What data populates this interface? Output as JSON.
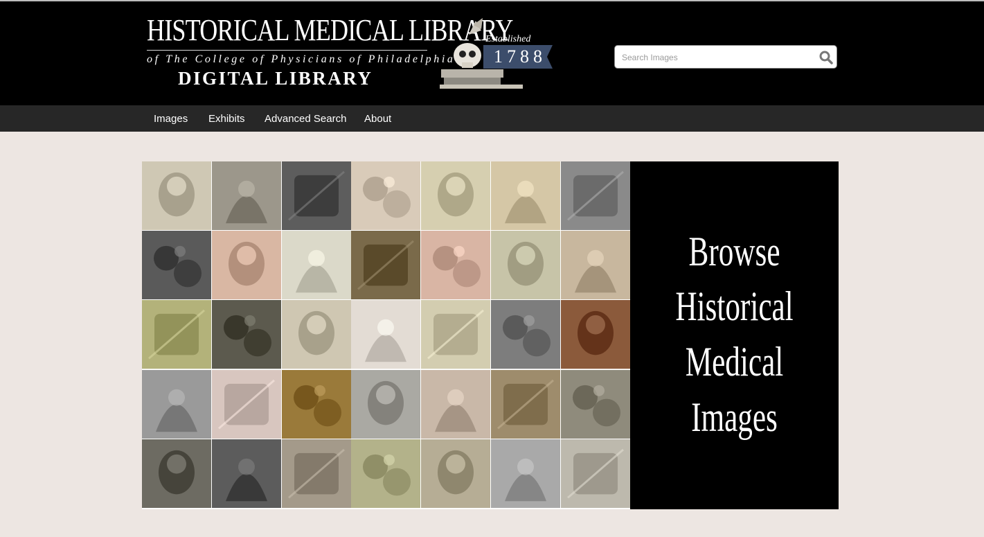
{
  "header": {
    "logo_line1": "HISTORICAL MEDICAL LIBRARY",
    "logo_line2": "of The College of Physicians of Philadelphia",
    "logo_line3": "DIGITAL LIBRARY",
    "badge_label": "Established",
    "badge_year": "1788"
  },
  "search": {
    "placeholder": "Search Images",
    "icon": "search-icon"
  },
  "nav": {
    "items": [
      "Images",
      "Exhibits",
      "Advanced Search",
      "About"
    ]
  },
  "browse": {
    "lines": [
      "Browse",
      "Historical",
      "Medical",
      "Images"
    ]
  },
  "mosaic": {
    "tile_count": 35,
    "tile_tones": [
      "#cfc8b4",
      "#9c978b",
      "#5d5d5d",
      "#d9cbb9",
      "#d6cfb0",
      "#d5c7a6",
      "#8a8a8a",
      "#5a5a5a",
      "#d9b7a3",
      "#dbd9c9",
      "#7a6a4a",
      "#d9b5a4",
      "#c7c4a8",
      "#c8b79e",
      "#b3b27a",
      "#5c5a4e",
      "#cfc7b2",
      "#e3dcd4",
      "#d3cdb0",
      "#7d7d7d",
      "#8b5a3b",
      "#9a9a9a",
      "#d8c6bf",
      "#9a7a3a",
      "#aaa9a3",
      "#c9b8a8",
      "#9e8c6c",
      "#8f8b7c",
      "#6d6b62",
      "#5c5c5c",
      "#a49a8a",
      "#b3b28a",
      "#b6ad95",
      "#a9a9a9",
      "#bdb9ad"
    ]
  },
  "colors": {
    "header_bg": "#000000",
    "nav_bg": "#272727",
    "page_bg": "#ede6e2",
    "badge_banner": "#3c4d6b"
  }
}
